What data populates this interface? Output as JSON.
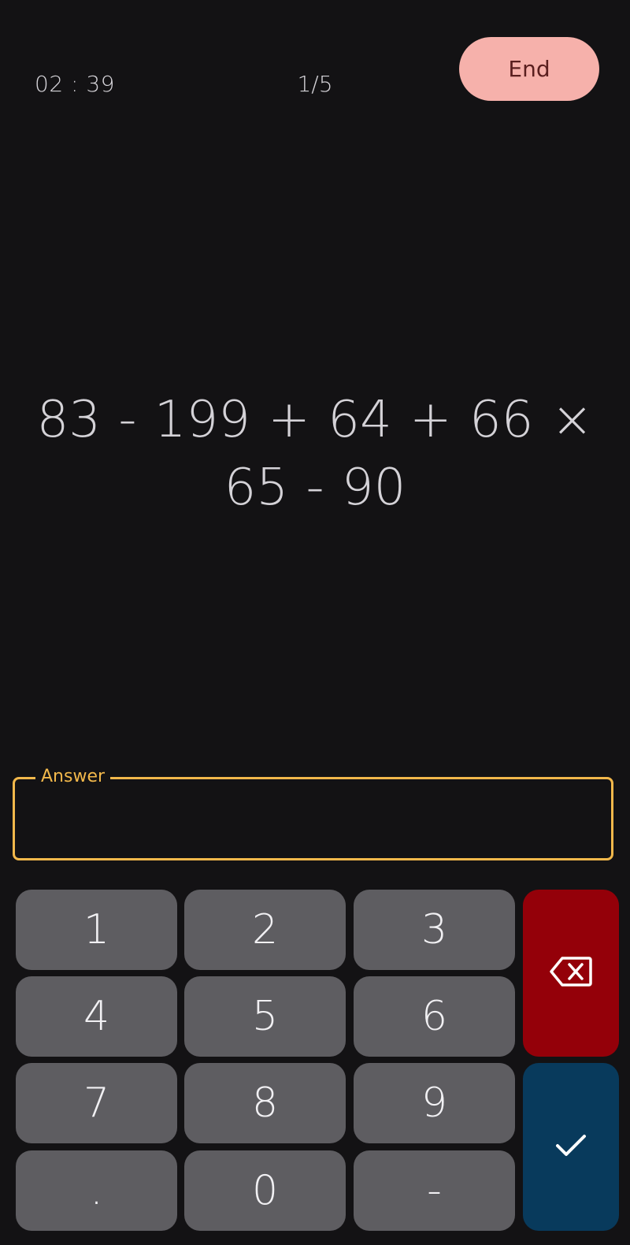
{
  "header": {
    "timer": "02 : 39",
    "progress": "1/5",
    "end_label": "End"
  },
  "question": {
    "expression": "83 - 199 + 64 + 66 × 65 - 90"
  },
  "answer": {
    "label": "Answer",
    "value": ""
  },
  "keypad": {
    "keys": [
      "1",
      "2",
      "3",
      "4",
      "5",
      "6",
      "7",
      "8",
      "9",
      ".",
      "0",
      "-"
    ],
    "backspace_icon": "backspace-icon",
    "submit_icon": "checkmark-icon"
  },
  "colors": {
    "background": "#131214",
    "end_button": "#f6b1ab",
    "answer_accent": "#f2b84b",
    "key": "#5e5d61",
    "backspace": "#940009",
    "submit": "#083a5c"
  }
}
